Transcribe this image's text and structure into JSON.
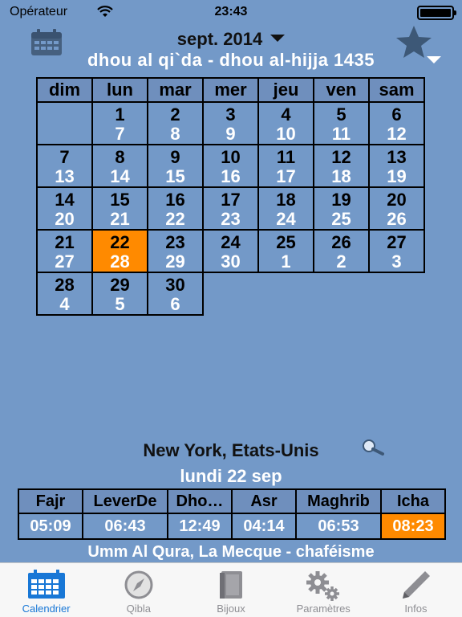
{
  "status_bar": {
    "carrier": "Opérateur",
    "time": "23:43"
  },
  "header": {
    "month": "sept. 2014",
    "hijri": "dhou al qi`da - dhou al-hijja 1435"
  },
  "calendar": {
    "weekdays": [
      "dim",
      "lun",
      "mar",
      "mer",
      "jeu",
      "ven",
      "sam"
    ],
    "days": [
      {
        "g": "1",
        "h": "7"
      },
      {
        "g": "2",
        "h": "8"
      },
      {
        "g": "3",
        "h": "9"
      },
      {
        "g": "4",
        "h": "10"
      },
      {
        "g": "5",
        "h": "11"
      },
      {
        "g": "6",
        "h": "12"
      },
      {
        "g": "7",
        "h": "13"
      },
      {
        "g": "8",
        "h": "14"
      },
      {
        "g": "9",
        "h": "15"
      },
      {
        "g": "10",
        "h": "16"
      },
      {
        "g": "11",
        "h": "17"
      },
      {
        "g": "12",
        "h": "18"
      },
      {
        "g": "13",
        "h": "19"
      },
      {
        "g": "14",
        "h": "20"
      },
      {
        "g": "15",
        "h": "21"
      },
      {
        "g": "16",
        "h": "22"
      },
      {
        "g": "17",
        "h": "23"
      },
      {
        "g": "18",
        "h": "24"
      },
      {
        "g": "19",
        "h": "25"
      },
      {
        "g": "20",
        "h": "26"
      },
      {
        "g": "21",
        "h": "27"
      },
      {
        "g": "22",
        "h": "28"
      },
      {
        "g": "23",
        "h": "29"
      },
      {
        "g": "24",
        "h": "30"
      },
      {
        "g": "25",
        "h": "1"
      },
      {
        "g": "26",
        "h": "2"
      },
      {
        "g": "27",
        "h": "3"
      },
      {
        "g": "28",
        "h": "4"
      },
      {
        "g": "29",
        "h": "5"
      },
      {
        "g": "30",
        "h": "6"
      }
    ],
    "selected_day": "22"
  },
  "location": {
    "city": "New York, Etats-Unis",
    "date": "lundi 22 sep"
  },
  "prayers": {
    "names": [
      "Fajr",
      "LeverDe",
      "Dho…",
      "Asr",
      "Maghrib",
      "Icha"
    ],
    "times": [
      "05:09",
      "06:43",
      "12:49",
      "04:14",
      "06:53",
      "08:23"
    ],
    "current": "Icha"
  },
  "method": "Umm Al Qura, La Mecque - chaféisme",
  "tabs": [
    {
      "label": "Calendrier",
      "icon": "calendar-icon",
      "active": true
    },
    {
      "label": "Qibla",
      "icon": "compass-icon",
      "active": false
    },
    {
      "label": "Bijoux",
      "icon": "book-icon",
      "active": false
    },
    {
      "label": "Paramètres",
      "icon": "gears-icon",
      "active": false
    },
    {
      "label": "Infos",
      "icon": "pencil-icon",
      "active": false
    }
  ],
  "colors": {
    "background": "#7399c8",
    "highlight": "#ff8a00",
    "active_tab": "#1877d6"
  }
}
